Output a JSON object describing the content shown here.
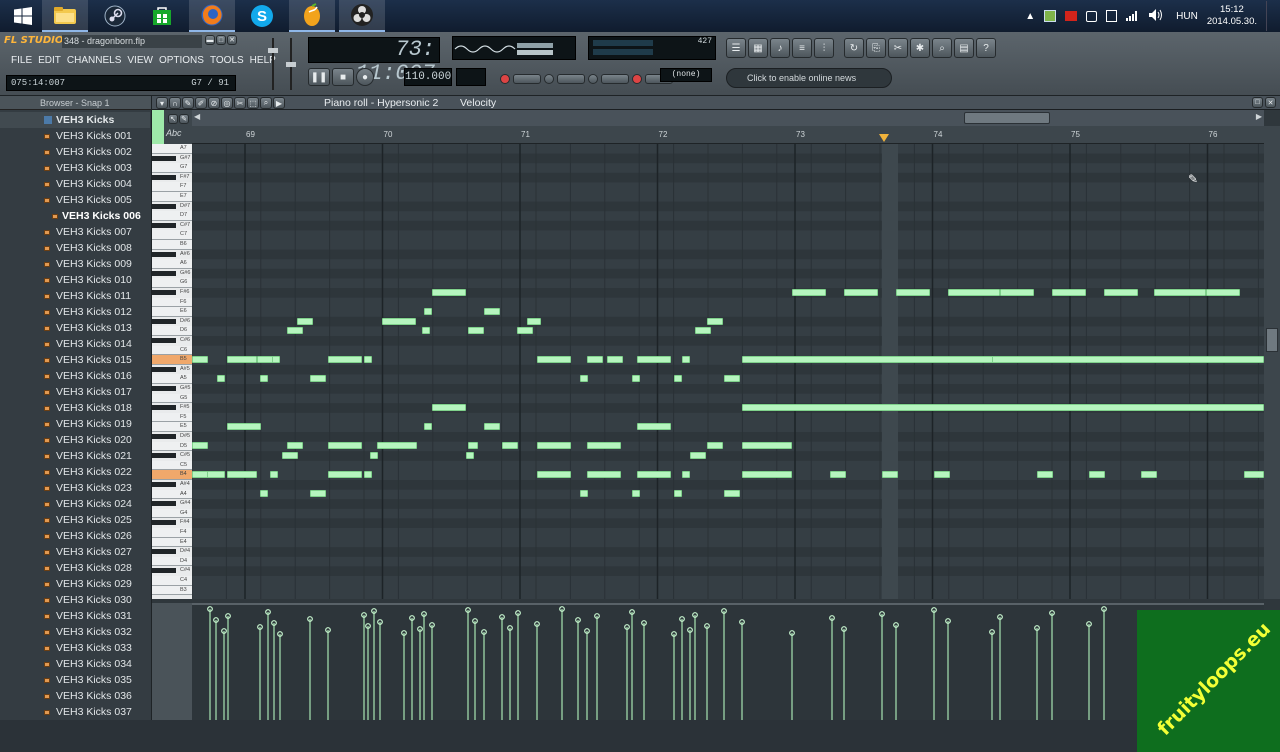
{
  "taskbar": {
    "apps": [
      {
        "name": "windows-start-icon"
      },
      {
        "name": "file-explorer-icon"
      },
      {
        "name": "steam-icon"
      },
      {
        "name": "store-icon"
      },
      {
        "name": "firefox-icon"
      },
      {
        "name": "skype-icon"
      },
      {
        "name": "fl-studio-icon"
      },
      {
        "name": "obs-icon"
      }
    ],
    "tray": {
      "language": "HUN",
      "time": "15:12",
      "date": "2014.05.30."
    }
  },
  "fl": {
    "logo": "FL STUDIO",
    "project_name": "348 - dragonborn.flp",
    "menus": [
      "FILE",
      "EDIT",
      "CHANNELS",
      "VIEW",
      "OPTIONS",
      "TOOLS",
      "HELP"
    ],
    "position_display": "075:14:007",
    "hint_display": "G7 / 91",
    "time_display": "73: 11:007",
    "cpu_value": "427",
    "pattern_value": "(none)",
    "online_news": "Click to enable online news",
    "tempo": "110.000"
  },
  "browser": {
    "title": "Browser - Snap 1",
    "folder": "VEH3 Kicks",
    "items": [
      "VEH3 Kicks 001",
      "VEH3 Kicks 002",
      "VEH3 Kicks 003",
      "VEH3 Kicks 004",
      "VEH3 Kicks 005",
      "VEH3 Kicks 006",
      "VEH3 Kicks 007",
      "VEH3 Kicks 008",
      "VEH3 Kicks 009",
      "VEH3 Kicks 010",
      "VEH3 Kicks 011",
      "VEH3 Kicks 012",
      "VEH3 Kicks 013",
      "VEH3 Kicks 014",
      "VEH3 Kicks 015",
      "VEH3 Kicks 016",
      "VEH3 Kicks 017",
      "VEH3 Kicks 018",
      "VEH3 Kicks 019",
      "VEH3 Kicks 020",
      "VEH3 Kicks 021",
      "VEH3 Kicks 022",
      "VEH3 Kicks 023",
      "VEH3 Kicks 024",
      "VEH3 Kicks 025",
      "VEH3 Kicks 026",
      "VEH3 Kicks 027",
      "VEH3 Kicks 028",
      "VEH3 Kicks 029",
      "VEH3 Kicks 030",
      "VEH3 Kicks 031",
      "VEH3 Kicks 032",
      "VEH3 Kicks 033",
      "VEH3 Kicks 034",
      "VEH3 Kicks 035",
      "VEH3 Kicks 036",
      "VEH3 Kicks 037"
    ],
    "selected_index": 5
  },
  "pianoroll": {
    "title": "Piano roll - Hypersonic 2",
    "mode": "Velocity",
    "bars": [
      "69",
      "70",
      "71",
      "72",
      "73",
      "74",
      "75",
      "76"
    ],
    "keyboard_label": "Abc",
    "key_labels": [
      "A7",
      "G#7",
      "G7",
      "F#7",
      "F7",
      "E7",
      "D#7",
      "D7",
      "C#7",
      "C7",
      "B6",
      "A#6",
      "A6",
      "G#6",
      "G6",
      "F#6",
      "F6",
      "E6",
      "D#6",
      "D6",
      "C#6",
      "C6",
      "B5",
      "A#5",
      "A5",
      "G#5",
      "G5",
      "F#5",
      "F5",
      "E5",
      "D#5",
      "D5",
      "C#5",
      "C5",
      "B4",
      "A#4",
      "A4",
      "G#4",
      "G4",
      "F#4",
      "F4",
      "E4",
      "D#4",
      "D4",
      "C#4",
      "C4",
      "B3"
    ]
  },
  "watermark": "fruityloops.eu"
}
